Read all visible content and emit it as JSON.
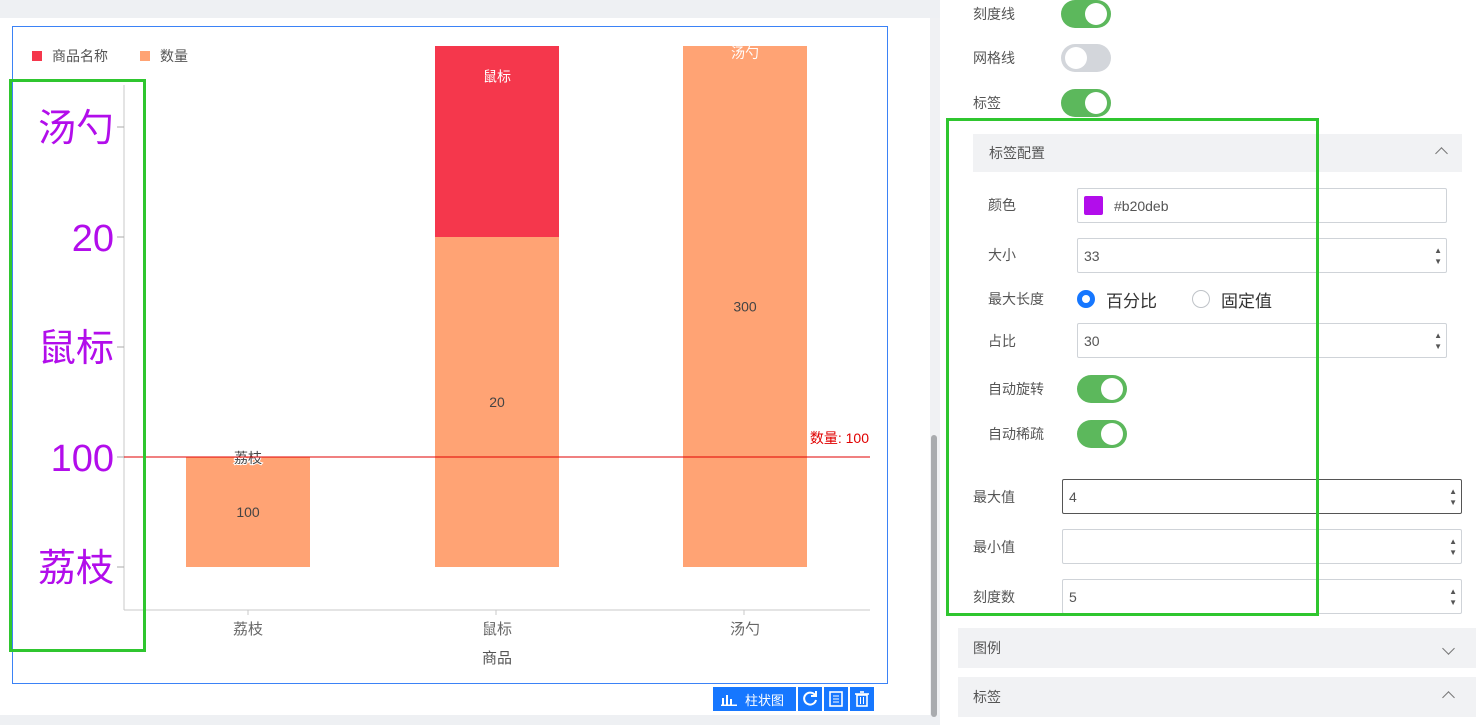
{
  "chart": {
    "legend": [
      {
        "name": "商品名称",
        "color": "#f5374c"
      },
      {
        "name": "数量",
        "color": "#ffa374"
      }
    ],
    "y_tick_labels": [
      "汤勺",
      "20",
      "鼠标",
      "100",
      "荔枝"
    ],
    "y_tick_color": "#b20deb",
    "markline_label": "数量: 100",
    "xlabel": "商品",
    "toolbar": {
      "chart_type_label": "柱状图"
    }
  },
  "chart_data": {
    "type": "bar",
    "stacked": true,
    "categories": [
      "荔枝",
      "鼠标",
      "汤勺"
    ],
    "xlabel": "商品",
    "series": [
      {
        "name": "数量",
        "color": "#ffa374",
        "values": [
          100,
          20,
          300
        ],
        "labels": [
          "100",
          "20",
          "300"
        ]
      },
      {
        "name": "商品名称",
        "color": "#f5374c",
        "labels": [
          "荔枝",
          "鼠标",
          "汤勺"
        ]
      }
    ],
    "markline": {
      "value": 100,
      "label": "数量: 100",
      "color": "#e00000"
    },
    "grid": false,
    "legend_position": "top-left"
  },
  "panel": {
    "toggles": [
      {
        "label": "刻度线",
        "on": true
      },
      {
        "label": "网格线",
        "on": false
      },
      {
        "label": "标签",
        "on": true
      }
    ],
    "label_config": {
      "title": "标签配置",
      "color_label": "颜色",
      "color_value": "#b20deb",
      "size_label": "大小",
      "size_value": "33",
      "max_length_label": "最大长度",
      "max_length_options": [
        "百分比",
        "固定值"
      ],
      "ratio_label": "占比",
      "ratio_value": "30",
      "auto_rotate_label": "自动旋转",
      "auto_thin_label": "自动稀疏"
    },
    "max_label": "最大值",
    "max_value": "4",
    "min_label": "最小值",
    "min_value": "",
    "ticks_label": "刻度数",
    "ticks_value": "5",
    "sections": [
      "图例",
      "标签"
    ]
  }
}
